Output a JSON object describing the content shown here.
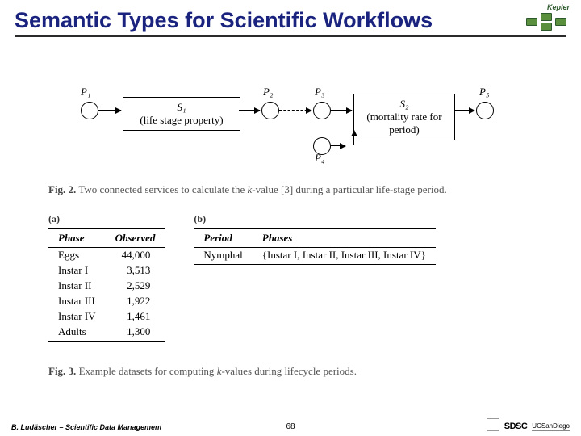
{
  "header": {
    "title": "Semantic Types for Scientific Workflows",
    "logo_text": "Kepler"
  },
  "diagram": {
    "ports": {
      "p1": "P₁",
      "p2": "P₂",
      "p3": "P₃",
      "p4": "P₄",
      "p5": "P₅"
    },
    "services": {
      "s1_name": "S₁",
      "s1_desc": "(life stage property)",
      "s2_name": "S₂",
      "s2_desc": "(mortality rate for period)"
    }
  },
  "captions": {
    "fig2_label": "Fig. 2.",
    "fig2_text_a": "Two connected services to calculate the ",
    "fig2_k": "k",
    "fig2_text_b": "-value [3] during a particular life-stage period.",
    "fig3_label": "Fig. 3.",
    "fig3_text_a": "Example datasets for computing ",
    "fig3_k": "k",
    "fig3_text_b": "-values during lifecycle periods."
  },
  "tables": {
    "a_label": "(a)",
    "b_label": "(b)",
    "a": {
      "headers": [
        "Phase",
        "Observed"
      ],
      "rows": [
        [
          "Eggs",
          "44,000"
        ],
        [
          "Instar I",
          "3,513"
        ],
        [
          "Instar II",
          "2,529"
        ],
        [
          "Instar III",
          "1,922"
        ],
        [
          "Instar IV",
          "1,461"
        ],
        [
          "Adults",
          "1,300"
        ]
      ]
    },
    "b": {
      "headers": [
        "Period",
        "Phases"
      ],
      "rows": [
        [
          "Nymphal",
          "{Instar I, Instar II, Instar III, Instar IV}"
        ]
      ]
    }
  },
  "footer": {
    "attribution": "B. Ludäscher – Scientific Data Management",
    "page": "68",
    "sdsc": "SDSC",
    "ucsd": "UCSanDiego"
  },
  "chart_data": {
    "type": "table",
    "title": "Example datasets for computing k-values during lifecycle periods",
    "tables": [
      {
        "name": "(a) Phase vs Observed",
        "columns": [
          "Phase",
          "Observed"
        ],
        "rows": [
          [
            "Eggs",
            44000
          ],
          [
            "Instar I",
            3513
          ],
          [
            "Instar II",
            2529
          ],
          [
            "Instar III",
            1922
          ],
          [
            "Instar IV",
            1461
          ],
          [
            "Adults",
            1300
          ]
        ]
      },
      {
        "name": "(b) Period vs Phases",
        "columns": [
          "Period",
          "Phases"
        ],
        "rows": [
          [
            "Nymphal",
            [
              "Instar I",
              "Instar II",
              "Instar III",
              "Instar IV"
            ]
          ]
        ]
      }
    ],
    "workflow": {
      "type": "diagram",
      "description": "Two connected services to calculate the k-value during a particular life-stage period",
      "nodes": [
        {
          "id": "P1",
          "kind": "port"
        },
        {
          "id": "S1",
          "kind": "service",
          "label": "life stage property"
        },
        {
          "id": "P2",
          "kind": "port"
        },
        {
          "id": "P3",
          "kind": "port"
        },
        {
          "id": "P4",
          "kind": "port"
        },
        {
          "id": "S2",
          "kind": "service",
          "label": "mortality rate for period"
        },
        {
          "id": "P5",
          "kind": "port"
        }
      ],
      "edges": [
        {
          "from": "P1",
          "to": "S1",
          "style": "solid"
        },
        {
          "from": "S1",
          "to": "P2",
          "style": "solid"
        },
        {
          "from": "P2",
          "to": "P3",
          "style": "dashed"
        },
        {
          "from": "P3",
          "to": "S2",
          "style": "solid"
        },
        {
          "from": "P4",
          "to": "S2",
          "style": "solid_up"
        },
        {
          "from": "S2",
          "to": "P5",
          "style": "solid"
        }
      ]
    }
  }
}
